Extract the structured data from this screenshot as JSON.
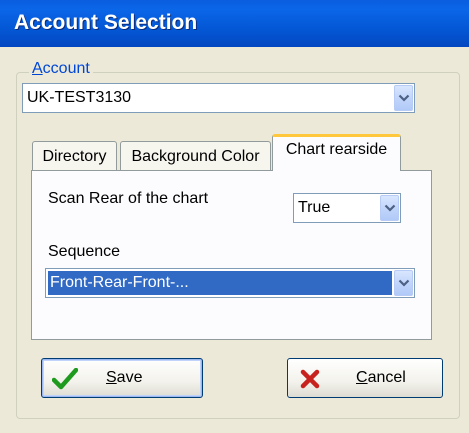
{
  "window": {
    "title": "Account Selection"
  },
  "account_group": {
    "legend_mnemonic": "A",
    "legend_rest": "ccount",
    "account_combo": {
      "value": "UK-TEST3130"
    }
  },
  "tabs": [
    {
      "label": "Directory"
    },
    {
      "label": "Background Color"
    },
    {
      "label": "Chart rearside"
    }
  ],
  "chart_rearside": {
    "scan_rear_label": "Scan Rear of the chart",
    "scan_rear_value": "True",
    "sequence_label": "Sequence",
    "sequence_value": "Front-Rear-Front-..."
  },
  "buttons": {
    "save": {
      "mnemonic": "S",
      "rest": "ave",
      "icon": "green-check-icon"
    },
    "cancel": {
      "mnemonic": "C",
      "rest": "ancel",
      "icon": "red-x-icon"
    }
  },
  "colors": {
    "title_bar": "#0458D6",
    "dialog_bg": "#ECE9D8",
    "selection": "#316AC5",
    "active_tab_accent": "#FFC83C"
  }
}
